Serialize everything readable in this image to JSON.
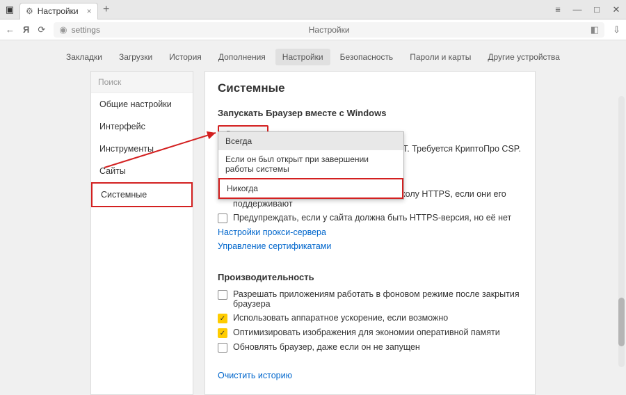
{
  "titlebar": {
    "tab_title": "Настройки",
    "close": "×",
    "newtab": "+"
  },
  "win": {
    "menu": "≡",
    "min": "—",
    "max": "□",
    "close": "✕"
  },
  "addr": {
    "url": "settings",
    "title": "Настройки",
    "back": "←",
    "ya": "Я",
    "reload": "⟳",
    "bookmark": "◧",
    "download": "⇩"
  },
  "tabs": {
    "items": [
      "Закладки",
      "Загрузки",
      "История",
      "Дополнения",
      "Настройки",
      "Безопасность",
      "Пароли и карты",
      "Другие устройства"
    ],
    "active": 4
  },
  "sidebar": {
    "search": "Поиск",
    "items": [
      "Общие настройки",
      "Интерфейс",
      "Инструменты",
      "Сайты",
      "Системные"
    ],
    "active": 4
  },
  "main": {
    "heading": "Системные",
    "section1": "Запускать Браузер вместе с Windows",
    "select_value": "Всегда",
    "dropdown": [
      "Всегда",
      "Если он был открыт при завершении работы системы",
      "Никогда"
    ],
    "gost_tail": "по ГОСТ. Требуется КриптоПро CSP.",
    "checks1": [
      {
        "checked": false,
        "label": "Автоматически открывать сайты по протоколу HTTPS, если они его поддерживают"
      },
      {
        "checked": false,
        "label": "Предупреждать, если у сайта должна быть HTTPS-версия, но её нет"
      }
    ],
    "link_proxy": "Настройки прокси-сервера",
    "link_cert": "Управление сертификатами",
    "section2": "Производительность",
    "checks2": [
      {
        "checked": false,
        "label": "Разрешать приложениям работать в фоновом режиме после закрытия браузера"
      },
      {
        "checked": true,
        "label": "Использовать аппаратное ускорение, если возможно"
      },
      {
        "checked": true,
        "label": "Оптимизировать изображения для экономии оперативной памяти"
      },
      {
        "checked": false,
        "label": "Обновлять браузер, даже если он не запущен"
      }
    ],
    "link_clear": "Очистить историю"
  }
}
